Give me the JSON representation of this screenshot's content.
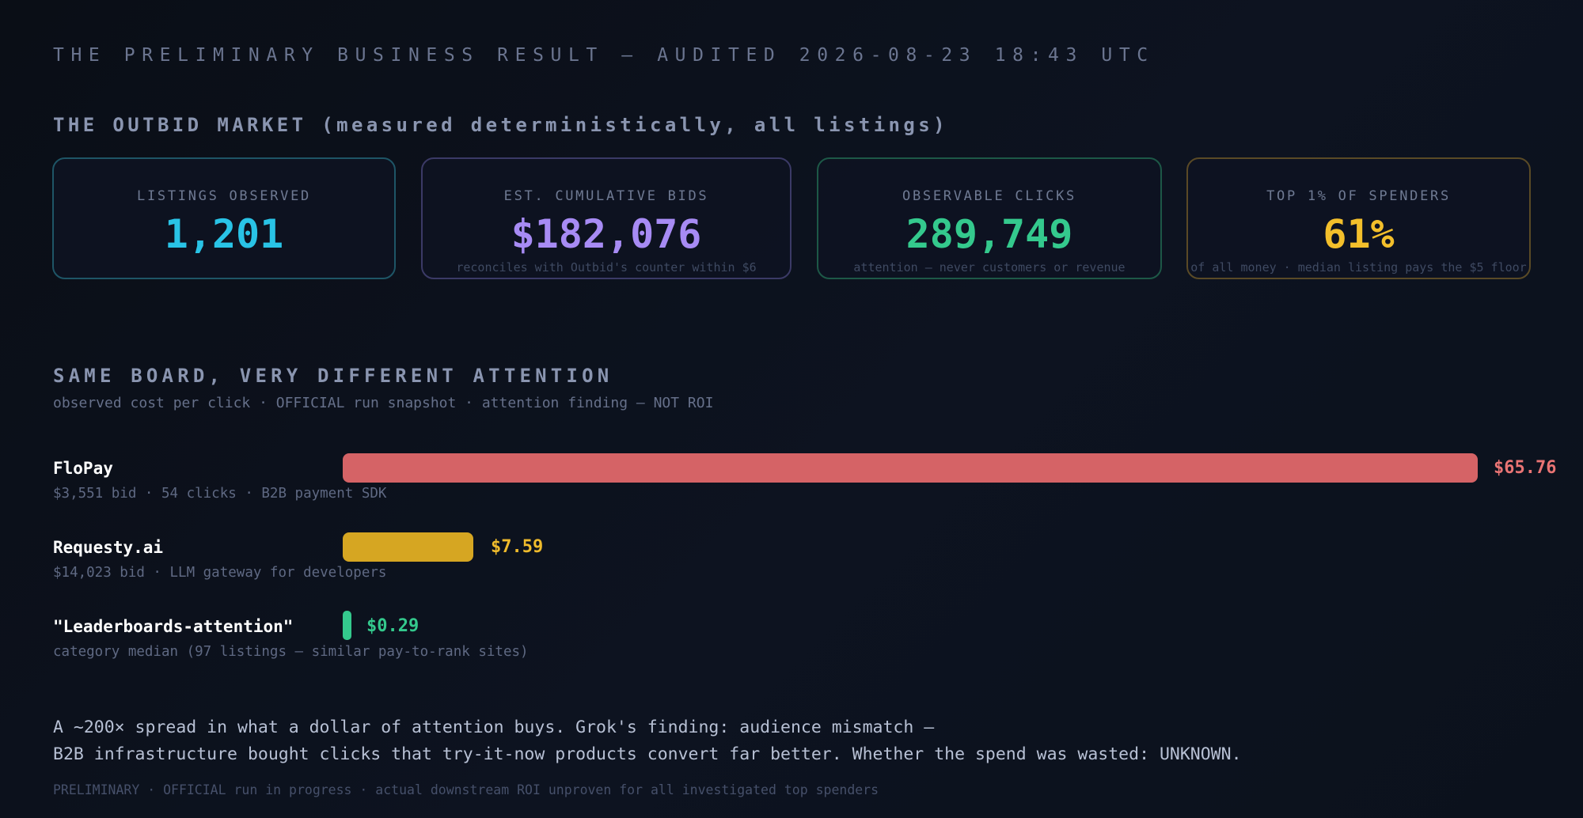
{
  "header": {
    "headline": "THE PRELIMINARY BUSINESS RESULT — AUDITED 2026-08-23 18:43 UTC"
  },
  "market": {
    "title": "THE OUTBID MARKET (measured deterministically, all listings)",
    "cards": [
      {
        "label": "LISTINGS OBSERVED",
        "value": "1,201",
        "note": "",
        "color": "#29c3e6"
      },
      {
        "label": "EST. CUMULATIVE BIDS",
        "value": "$182,076",
        "note": "reconciles with Outbid's counter within $6",
        "color": "#a78bf4"
      },
      {
        "label": "OBSERVABLE CLICKS",
        "value": "289,749",
        "note": "attention — never customers or revenue",
        "color": "#34c98d"
      },
      {
        "label": "TOP 1% OF SPENDERS",
        "value": "61%",
        "note": "of all money · median listing pays the $5 floor",
        "color": "#f3bf2b"
      }
    ]
  },
  "board": {
    "title": "SAME BOARD, VERY DIFFERENT ATTENTION",
    "subtitle": "observed cost per click · OFFICIAL run snapshot · attention finding — NOT ROI",
    "rows": [
      {
        "name": "FloPay",
        "meta": "$3,551 bid · 54 clicks · B2B payment SDK",
        "value_label": "$65.76",
        "cost_per_click": 65.76,
        "color": "#d56366"
      },
      {
        "name": "Requesty.ai",
        "meta": "$14,023 bid · LLM gateway for developers",
        "value_label": "$7.59",
        "cost_per_click": 7.59,
        "color": "#d6a622"
      },
      {
        "name": "\"Leaderboards-attention\"",
        "meta": "category median (97 listings — similar pay-to-rank sites)",
        "value_label": "$0.29",
        "cost_per_click": 0.29,
        "color": "#34c98d"
      }
    ]
  },
  "conclusion": {
    "line1": "A ~200× spread in what a dollar of attention buys. Grok's finding: audience mismatch —",
    "line2": "B2B infrastructure bought clicks that try-it-now products convert far better. Whether the spend was wasted: UNKNOWN.",
    "footnote": "PRELIMINARY · OFFICIAL run in progress · actual downstream ROI unproven for all investigated top spenders"
  }
}
